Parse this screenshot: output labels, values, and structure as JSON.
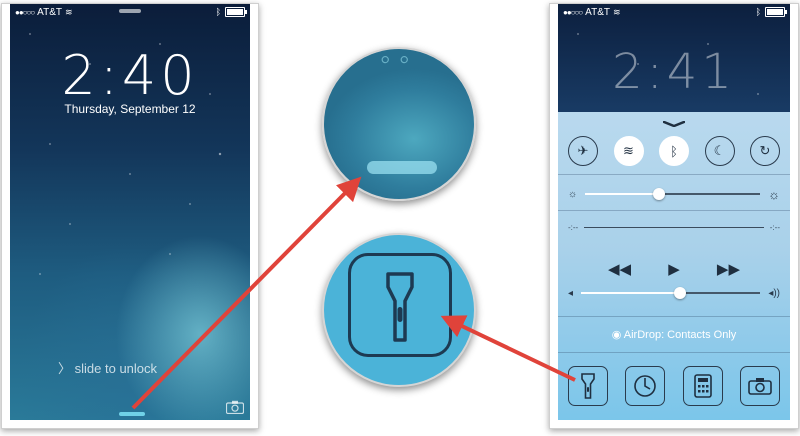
{
  "lock_screen": {
    "status": {
      "signal": "●●○○○",
      "carrier": "AT&T"
    },
    "time": "2:40",
    "date": "Thursday, September 12",
    "slide_prompt": "slide to unlock"
  },
  "control_center": {
    "status": {
      "signal": "●●○○○",
      "carrier": "AT&T"
    },
    "time": "2:41",
    "toggles": [
      {
        "name": "airplane",
        "glyph": "✈",
        "on": false
      },
      {
        "name": "wifi",
        "glyph": "≋",
        "on": true
      },
      {
        "name": "bluetooth",
        "glyph": "ᛒ",
        "on": true
      },
      {
        "name": "do-not-disturb",
        "glyph": "☾",
        "on": false
      },
      {
        "name": "rotation-lock",
        "glyph": "↻",
        "on": false
      }
    ],
    "brightness_level": 0.42,
    "volume_level": 0.55,
    "transport": {
      "prev": "◀◀",
      "play": "▶",
      "next": "▶▶"
    },
    "airdrop_label": "AirDrop: Contacts Only",
    "quick_launch": [
      "flashlight-icon",
      "timer-icon",
      "calculator-icon",
      "camera-icon"
    ]
  },
  "annotation_arrows": {
    "color": "#e0433a"
  }
}
